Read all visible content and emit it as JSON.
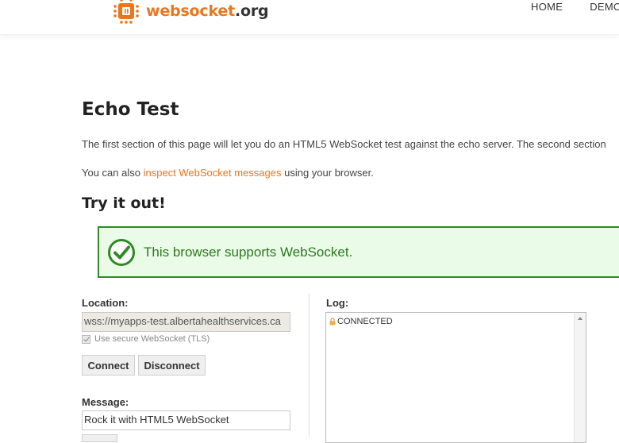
{
  "header": {
    "logo_prefix": "websocket",
    "logo_suffix": ".org",
    "nav": [
      "HOME",
      "DEMOS"
    ]
  },
  "page": {
    "title": "Echo Test",
    "intro": "The first section of this page will let you do an HTML5 WebSocket test against the echo server. The second section",
    "intro2_before": "You can also ",
    "intro2_link": "inspect WebSocket messages",
    "intro2_after": " using your browser.",
    "subtitle": "Try it out!",
    "support_message": "This browser supports WebSocket."
  },
  "form": {
    "location_label": "Location:",
    "location_value": "wss://myapps-test.albertahealthservices.ca",
    "tls_label": "Use secure WebSocket (TLS)",
    "tls_checked": true,
    "connect_label": "Connect",
    "disconnect_label": "Disconnect",
    "message_label": "Message:",
    "message_value": "Rock it with HTML5 WebSocket"
  },
  "log": {
    "label": "Log:",
    "entries": [
      "CONNECTED"
    ]
  },
  "colors": {
    "accent": "#e8771f",
    "success_border": "#2e8b23",
    "success_bg": "#eafbe8"
  },
  "icons": [
    "websocket-logo-icon",
    "check-circle-icon",
    "lock-icon",
    "scroll-up-icon"
  ]
}
